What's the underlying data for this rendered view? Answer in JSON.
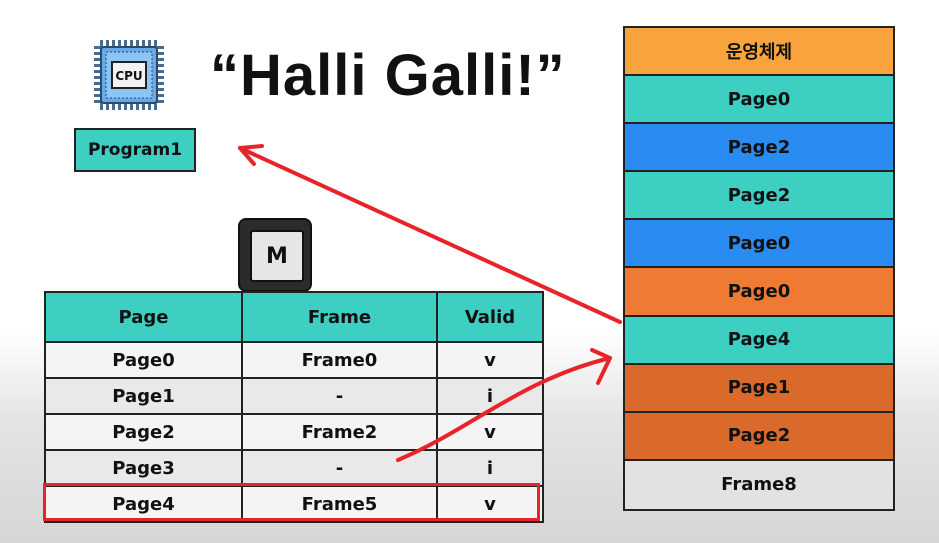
{
  "title": "“Halli Galli!”",
  "cpu": {
    "label": "CPU",
    "program": "Program1"
  },
  "key_label": "M",
  "page_table": {
    "headers": [
      "Page",
      "Frame",
      "Valid"
    ],
    "rows": [
      [
        "Page0",
        "Frame0",
        "v"
      ],
      [
        "Page1",
        "-",
        "i"
      ],
      [
        "Page2",
        "Frame2",
        "v"
      ],
      [
        "Page3",
        "-",
        "i"
      ],
      [
        "Page4",
        "Frame5",
        "v"
      ]
    ],
    "highlighted_row": "Page4"
  },
  "memory": [
    {
      "label": "운영체제",
      "color": "#f9a33e"
    },
    {
      "label": "Page0",
      "color": "#3ecfc3"
    },
    {
      "label": "Page2",
      "color": "#2a8cf0"
    },
    {
      "label": "Page2",
      "color": "#3ecfc3"
    },
    {
      "label": "Page0",
      "color": "#2a8cf0"
    },
    {
      "label": "Page0",
      "color": "#ef7a33"
    },
    {
      "label": "Page4",
      "color": "#3ecfc3"
    },
    {
      "label": "Page1",
      "color": "#d96a2c"
    },
    {
      "label": "Page2",
      "color": "#d96a2c"
    },
    {
      "label": "Frame8",
      "color": "#e2e2e2"
    }
  ],
  "colors": {
    "teal": "#3ecfc3",
    "arrow": "#e8242a",
    "highlight": "#e8242a"
  }
}
